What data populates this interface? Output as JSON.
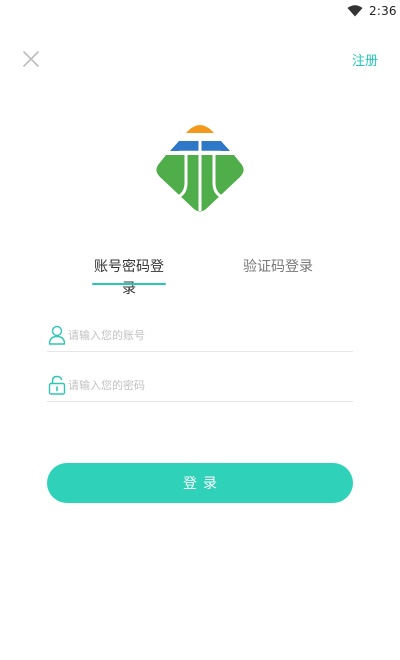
{
  "status_bar": {
    "time": "2:36"
  },
  "header": {
    "register_label": "注册"
  },
  "tabs": [
    {
      "label": "账号密码登录",
      "active": true
    },
    {
      "label": "验证码登录",
      "active": false
    }
  ],
  "form": {
    "account": {
      "placeholder": "请输入您的账号",
      "value": ""
    },
    "password": {
      "placeholder": "请输入您的密码",
      "value": ""
    }
  },
  "login_button": {
    "label": "登录"
  },
  "icons": {
    "close": "close-icon",
    "user": "user-icon",
    "lock": "lock-icon",
    "wifi": "wifi-icon",
    "logo": "app-logo"
  },
  "colors": {
    "accent": "#22c9b8",
    "button": "#2fd1b8",
    "logo_orange": "#f39a1e",
    "logo_blue": "#2f78c8",
    "logo_green": "#4fae4a"
  }
}
